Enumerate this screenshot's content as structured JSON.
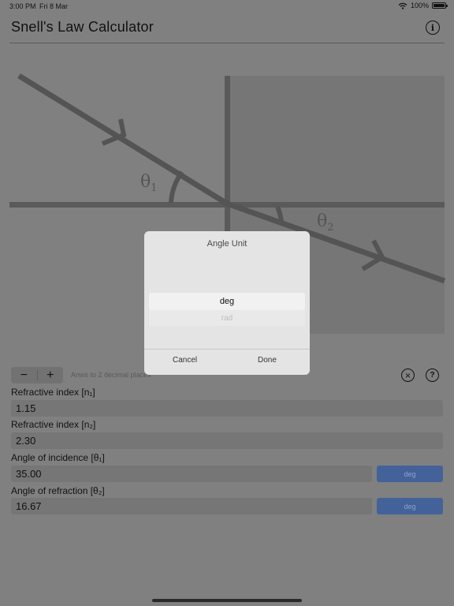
{
  "status": {
    "time": "3:00 PM",
    "date": "Fri 8 Mar",
    "battery": "100%",
    "wifi_icon": "wifi-icon",
    "battery_icon": "battery-icon"
  },
  "header": {
    "title": "Snell's Law Calculator",
    "info_icon": "info-circle-icon"
  },
  "diagram": {
    "theta1": "θ",
    "theta1_sub": "1",
    "theta2": "θ",
    "theta2_sub": "2"
  },
  "controls": {
    "decrement": "−",
    "increment": "+",
    "precision_note": "Anws to 2 decimal places",
    "clear_icon": "close-circle-icon",
    "help_icon": "question-circle-icon"
  },
  "fields": {
    "n1": {
      "label": "Refractive index [n₁]",
      "value": "1.15"
    },
    "n2": {
      "label": "Refractive index [n₂]",
      "value": "2.30"
    },
    "incidence": {
      "label": "Angle of incidence [θ₁]",
      "value": "35.00",
      "unit": "deg"
    },
    "refraction": {
      "label": "Angle of refraction [θ₂]",
      "value": "16.67",
      "unit": "deg"
    }
  },
  "dialog": {
    "title": "Angle Unit",
    "options": [
      "deg",
      "rad"
    ],
    "selected": "deg",
    "cancel": "Cancel",
    "done": "Done"
  },
  "colors": {
    "unit_button": "#43629a",
    "background_dimmed": "#808080",
    "dialog": "#e4e4e4"
  }
}
